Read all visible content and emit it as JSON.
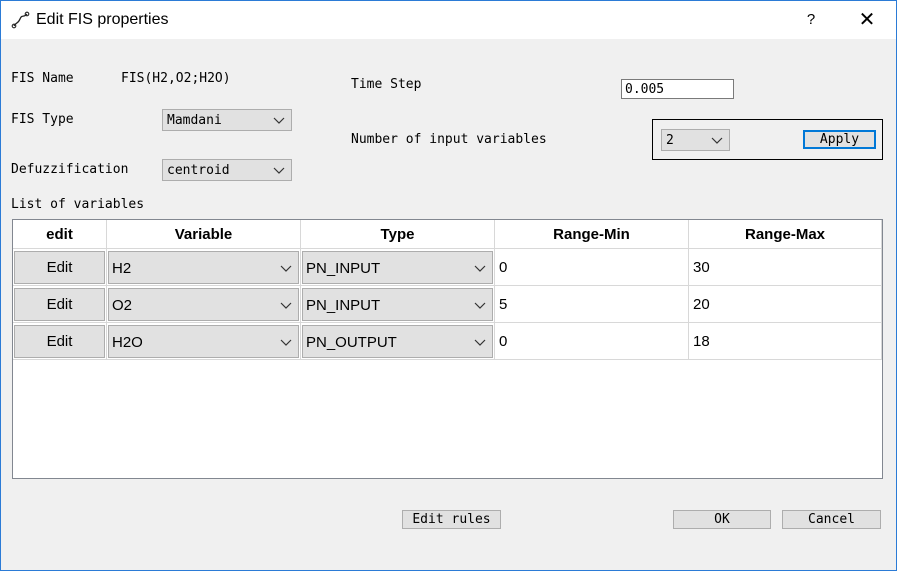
{
  "window": {
    "title": "Edit FIS properties",
    "help_label": "?",
    "close_label": "✕"
  },
  "fis": {
    "name_label": "FIS Name",
    "name_value": "FIS(H2,O2;H2O)",
    "type_label": "FIS Type",
    "type_value": "Mamdani",
    "defuzz_label": "Defuzzification",
    "defuzz_value": "centroid",
    "time_step_label": "Time Step",
    "time_step_value": "0.005",
    "num_inputs_label": "Number of input variables",
    "num_inputs_value": "2",
    "apply_label": "Apply"
  },
  "variables": {
    "list_label": "List of variables",
    "headers": [
      "edit",
      "Variable",
      "Type",
      "Range-Min",
      "Range-Max"
    ],
    "rows": [
      {
        "edit": "Edit",
        "variable": "H2",
        "type": "PN_INPUT",
        "min": "0",
        "max": "30"
      },
      {
        "edit": "Edit",
        "variable": "O2",
        "type": "PN_INPUT",
        "min": "5",
        "max": "20"
      },
      {
        "edit": "Edit",
        "variable": "H2O",
        "type": "PN_OUTPUT",
        "min": "0",
        "max": "18"
      }
    ]
  },
  "footer": {
    "edit_rules_label": "Edit rules",
    "ok_label": "OK",
    "cancel_label": "Cancel"
  },
  "icons": {
    "app": "fis-app-icon",
    "chevron": "chevron-down-icon",
    "help": "help-icon",
    "close": "close-icon"
  },
  "colors": {
    "accent": "#0078d7",
    "window_border": "#2b7bd6"
  }
}
